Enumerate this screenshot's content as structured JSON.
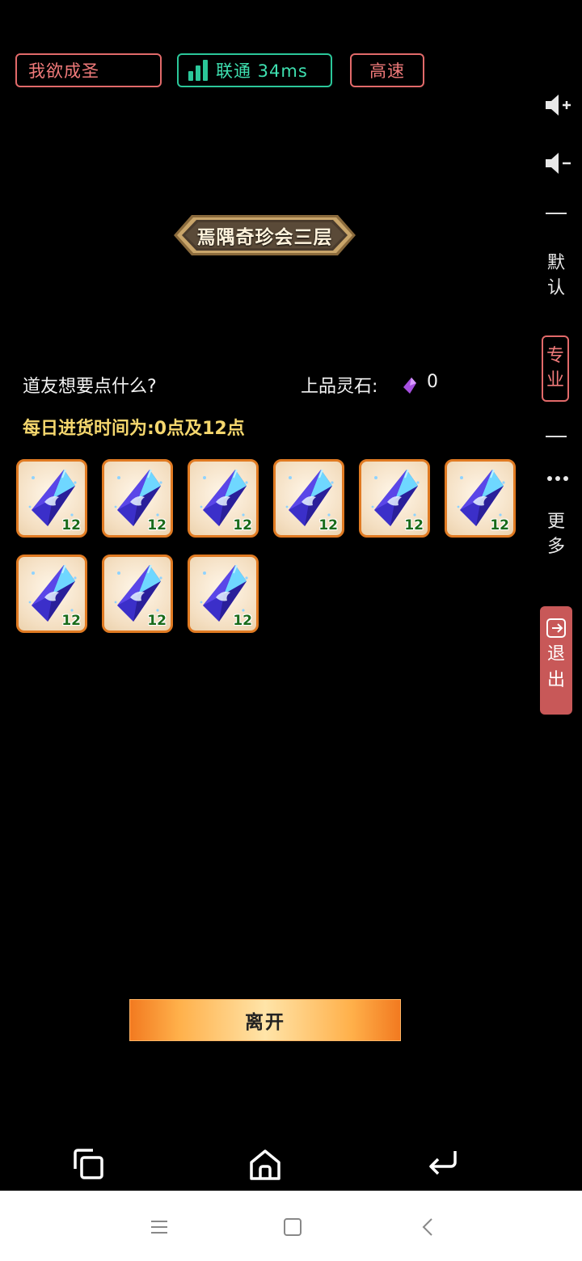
{
  "status_bar": {
    "game_name": "我欲成圣",
    "network_label": "联通 34ms",
    "speed_label": "高速"
  },
  "side_toolbar": {
    "volume_up_icon": "speaker-plus-icon",
    "volume_down_icon": "speaker-minus-icon",
    "default_label": "默认",
    "pro_label": "专业",
    "more_icon": "ellipsis-icon",
    "more_label": "更多",
    "exit_label": "退出"
  },
  "shop": {
    "title": "焉隅奇珍会三层",
    "prompt": "道友想要点什么?",
    "stone_label": "上品灵石:",
    "stone_count": "0",
    "restock_text": "每日进货时间为:0点及12点",
    "items": [
      {
        "icon": "blue-crystal-icon",
        "count": "12"
      },
      {
        "icon": "blue-crystal-icon",
        "count": "12"
      },
      {
        "icon": "blue-crystal-icon",
        "count": "12"
      },
      {
        "icon": "blue-crystal-icon",
        "count": "12"
      },
      {
        "icon": "blue-crystal-icon",
        "count": "12"
      },
      {
        "icon": "blue-crystal-icon",
        "count": "12"
      },
      {
        "icon": "blue-crystal-icon",
        "count": "12"
      },
      {
        "icon": "blue-crystal-icon",
        "count": "12"
      },
      {
        "icon": "blue-crystal-icon",
        "count": "12"
      }
    ],
    "leave_label": "离开"
  },
  "bottom_nav": {
    "copy_icon": "copy-window-icon",
    "home_icon": "home-icon",
    "back_icon": "return-arrow-icon"
  },
  "system_nav": {
    "menu_icon": "menu-icon",
    "home_icon": "square-home-icon",
    "back_icon": "chevron-left-icon"
  },
  "colors": {
    "background": "#000000",
    "accent_red": "#e26a6a",
    "accent_green": "#2bc79a",
    "restock_yellow": "#f5d76e",
    "item_border": "#e07a22",
    "exit_button": "#c85858"
  }
}
